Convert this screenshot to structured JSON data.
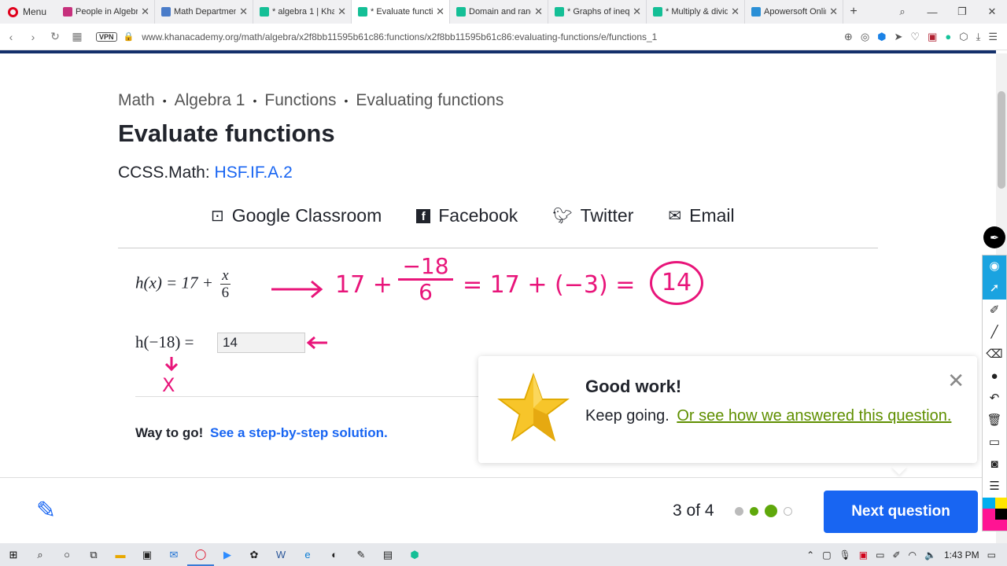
{
  "browser": {
    "menu_label": "Menu",
    "tabs": [
      {
        "title": "People in Algebra",
        "color": "#c6307c"
      },
      {
        "title": "Math Department",
        "color": "#4a7cc9"
      },
      {
        "title": "* algebra 1 | Khan",
        "color": "#14bf96"
      },
      {
        "title": "* Evaluate functions",
        "color": "#14bf96"
      },
      {
        "title": "Domain and range",
        "color": "#14bf96"
      },
      {
        "title": "* Graphs of inequalities",
        "color": "#14bf96"
      },
      {
        "title": "* Multiply & divide",
        "color": "#14bf96"
      },
      {
        "title": "Apowersoft Online",
        "color": "#2a8fd6"
      }
    ],
    "url": "www.khanacademy.org/math/algebra/x2f8bb11595b61c86:functions/x2f8bb11595b61c86:evaluating-functions/e/functions_1",
    "vpn_label": "VPN"
  },
  "breadcrumb": [
    "Math",
    "Algebra 1",
    "Functions",
    "Evaluating functions"
  ],
  "page_title": "Evaluate functions",
  "standard": {
    "prefix": "CCSS.Math:",
    "code": "HSF.IF.A.2"
  },
  "share": [
    {
      "label": "Google Classroom",
      "icon": "classroom-icon"
    },
    {
      "label": "Facebook",
      "icon": "facebook-icon"
    },
    {
      "label": "Twitter",
      "icon": "twitter-icon"
    },
    {
      "label": "Email",
      "icon": "email-icon"
    }
  ],
  "problem": {
    "func_lhs": "h(x) = 17 + ",
    "frac_num": "x",
    "frac_den": "6",
    "question_lhs": "h(−18) = ",
    "answer_value": "14"
  },
  "handwriting": {
    "step1": "17 +",
    "frac_num": "−18",
    "frac_den": "6",
    "step2": "= 17 + (−3) =",
    "result": "14",
    "mark": "X"
  },
  "hint": {
    "prefix": "Way to go!",
    "link": "See a step-by-step solution."
  },
  "feedback": {
    "title": "Good work!",
    "message": "Keep going.",
    "link": "Or see how we answered this question."
  },
  "footer": {
    "progress": "3 of 4",
    "next_label": "Next question"
  },
  "taskbar": {
    "time": "1:43 PM"
  }
}
